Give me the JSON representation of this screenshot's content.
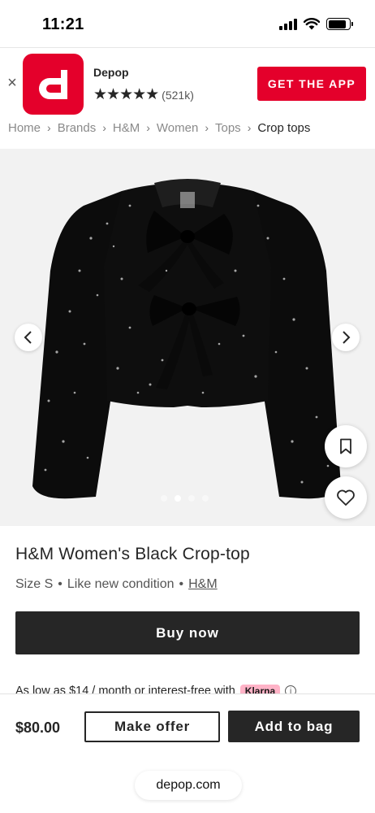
{
  "status_bar": {
    "time": "11:21",
    "signal_icon": "cellular-signal-icon",
    "wifi_icon": "wifi-icon",
    "battery_icon": "battery-icon",
    "battery_level": 0.85
  },
  "app_banner": {
    "close_icon": "close-icon",
    "app_icon": "depop-logo-icon",
    "app_name": "Depop",
    "stars": "★★★★★",
    "rating_count": "(521k)",
    "cta_label": "GET THE APP",
    "brand_color": "#e4002b"
  },
  "breadcrumb": {
    "items": [
      "Home",
      "Brands",
      "H&M",
      "Women",
      "Tops",
      "Crop tops"
    ],
    "separator": "›"
  },
  "product": {
    "image_alt": "black sequin cropped jacket with satin bows",
    "carousel_prev_icon": "chevron-left-icon",
    "carousel_next_icon": "chevron-right-icon",
    "image_count": 4,
    "active_image_index": 1,
    "save_icon": "bookmark-icon",
    "like_icon": "heart-icon",
    "title": "H&M Women's Black Crop-top",
    "size": "Size S",
    "bullet": "•",
    "condition": "Like new condition",
    "brand": "H&M",
    "buy_now_label": "Buy now",
    "finance_text": "As low as $14 / month or interest-free with",
    "klarna_label": "Klarna",
    "info_icon": "info-icon"
  },
  "bottom_bar": {
    "price": "$80.00",
    "make_offer_label": "Make offer",
    "add_to_bag_label": "Add to bag"
  },
  "browser": {
    "url": "depop.com"
  }
}
